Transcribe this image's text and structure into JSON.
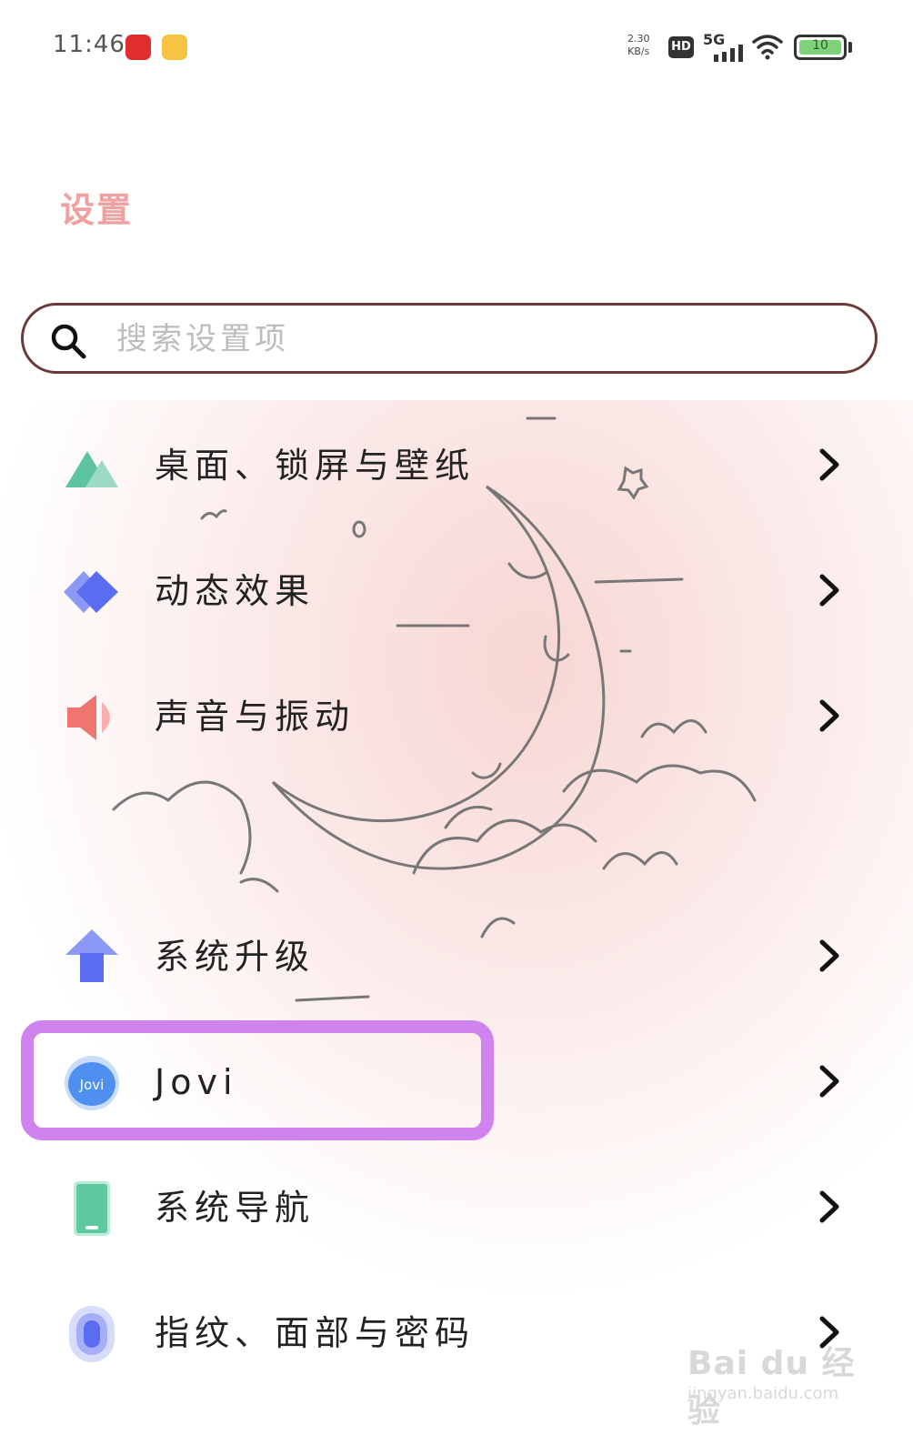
{
  "status_bar": {
    "time": "11:46",
    "speed_value": "2.30",
    "speed_unit": "KB/s",
    "hd": "HD",
    "network": "5G",
    "battery": "10"
  },
  "header": {
    "title": "设置"
  },
  "search": {
    "placeholder": "搜索设置项"
  },
  "settings": {
    "items": [
      {
        "label": "桌面、锁屏与壁纸",
        "icon": "mountain-icon"
      },
      {
        "label": "动态效果",
        "icon": "diamond-icon"
      },
      {
        "label": "声音与振动",
        "icon": "speaker-icon"
      },
      {
        "label": "系统升级",
        "icon": "upgrade-arrow-icon"
      },
      {
        "label": "Jovi",
        "icon": "jovi-icon",
        "icon_text": "Jovi"
      },
      {
        "label": "系统导航",
        "icon": "phone-navigation-icon"
      },
      {
        "label": "指纹、面部与密码",
        "icon": "fingerprint-icon"
      }
    ]
  },
  "highlight": {
    "color": "#d083ee",
    "target": "Jovi"
  },
  "watermark": {
    "main": "Bai du 经验",
    "sub": "jingyan.baidu.com"
  },
  "colors": {
    "title": "#f0a0a0",
    "search_border": "#6a3a3a"
  }
}
